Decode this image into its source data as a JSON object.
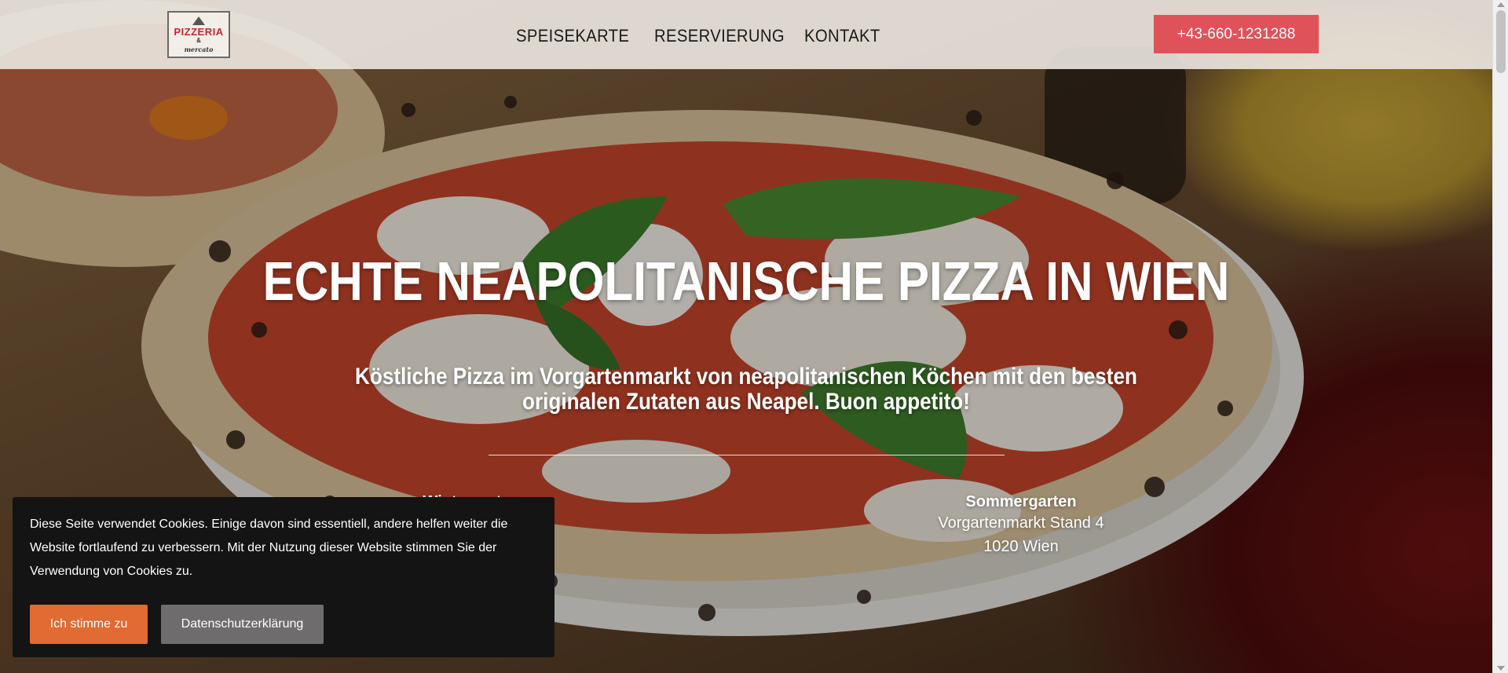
{
  "logo": {
    "main": "PIZZERIA",
    "amp": "&",
    "sub": "mercato"
  },
  "nav": {
    "items": [
      {
        "label": "SPEISEKARTE"
      },
      {
        "label": "RESERVIERUNG"
      },
      {
        "label": "KONTAKT"
      }
    ],
    "phone": "+43-660-1231288"
  },
  "hero": {
    "title": "ECHTE NEAPOLITANISCHE PIZZA IN WIEN",
    "subtitle": "Köstliche Pizza im Vorgartenmarkt von neapolitanischen Köchen mit den besten originalen Zutaten aus Neapel. Buon appetito!",
    "locations": [
      {
        "title": "Wintergarten",
        "lines": [
          "",
          ""
        ]
      },
      {
        "title": "Sommergarten",
        "lines": [
          "Vorgartenmarkt Stand 4",
          "1020 Wien"
        ]
      }
    ]
  },
  "cookie": {
    "text": "Diese Seite verwendet Cookies. Einige davon sind essentiell, andere helfen weiter die Website fortlaufend zu verbessern. Mit der Nutzung dieser Website stimmen Sie der Verwendung von Cookies zu.",
    "accept_label": "Ich stimme zu",
    "privacy_label": "Datenschutzerklärung"
  },
  "colors": {
    "phone_button": "#e0525a",
    "accept_button": "#e26a33",
    "privacy_button": "#6e6c6c",
    "cookie_bg": "#141414"
  }
}
